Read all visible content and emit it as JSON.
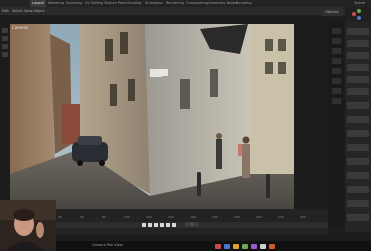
{
  "topbar": {
    "tabs": [
      "Layout",
      "Modeling",
      "Sculpting",
      "UV Editing",
      "Texture Paint",
      "Shading",
      "Animation",
      "Rendering",
      "Compositing",
      "Geometry Nodes",
      "Scripting"
    ],
    "active_tab": "Layout",
    "scene": "Scene"
  },
  "header": {
    "items": [
      "Edit",
      "Select",
      "View",
      "Object"
    ],
    "options": "Options"
  },
  "viewport": {
    "label": "Camera"
  },
  "timeline": {
    "ticks": [
      "0",
      "20",
      "40",
      "60",
      "80",
      "100",
      "120",
      "140",
      "160",
      "180",
      "200",
      "220",
      "240",
      "260"
    ],
    "current_frame": "1"
  },
  "statusbar": {
    "text": "Camera Pan View"
  },
  "colors": {
    "accent": "#e6e6e6",
    "active_tab_bg": "#3a3a3a",
    "panel_bg": "#252525"
  }
}
